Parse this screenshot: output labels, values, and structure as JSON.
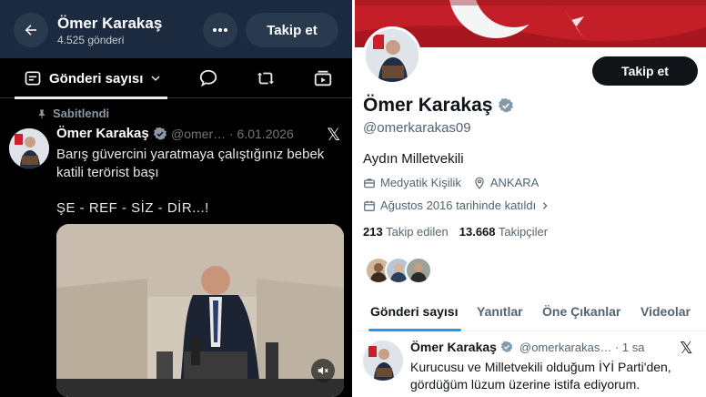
{
  "left_panel": {
    "header": {
      "title": "Ömer Karakaş",
      "post_count": "4.525 gönderi",
      "follow_label": "Takip et"
    },
    "tabs": {
      "active_label": "Gönderi sayısı"
    },
    "pinned_label": "Sabitlendi",
    "post": {
      "author": "Ömer Karakaş",
      "handle": "@omer…",
      "date": "· 6.01.2026",
      "text": "Barış güvercini yaratmaya çalıştığınız bebek katili terörist başı",
      "text2": "ŞE - REF - SİZ - DİR...!"
    }
  },
  "right_panel": {
    "follow_label": "Takip et",
    "name": "Ömer Karakaş",
    "handle": "@omerkarakas09",
    "bio": "Aydın Milletvekili",
    "category": "Medyatik Kişilik",
    "location": "ANKARA",
    "joined": "Ağustos 2016 tarihinde katıldı",
    "following_count": "213",
    "following_label": "Takip edilen",
    "followers_count": "13.668",
    "followers_label": "Takipçiler",
    "tabs": [
      "Gönderi sayısı",
      "Yanıtlar",
      "Öne Çıkanlar",
      "Videolar"
    ],
    "post": {
      "author": "Ömer Karakaş",
      "handle": "@omerkarakas…",
      "time": "· 1 sa",
      "text": "Kurucusu ve Milletvekili olduğum İYİ Parti'den, gördüğüm lüzum üzerine istifa ediyorum."
    }
  },
  "colors": {
    "dark_bg": "#000000",
    "dark_header": "#1b2a3e",
    "verified_blue": "#8b98a5",
    "tab_underline_blue": "#1d9bf0",
    "flag_red": "#c8202a"
  }
}
